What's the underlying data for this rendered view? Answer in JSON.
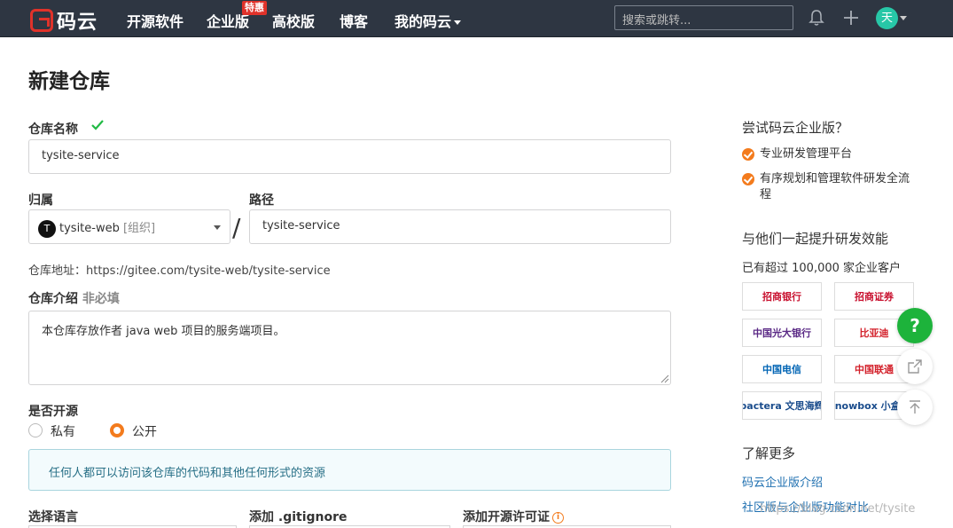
{
  "nav": {
    "logo_text": "码云",
    "items": [
      "开源软件",
      "企业版",
      "高校版",
      "博客",
      "我的码云"
    ],
    "badge": "特惠",
    "search_placeholder": "搜索或跳转...",
    "avatar_letter": "天"
  },
  "form": {
    "page_title": "新建仓库",
    "repo_name_label": "仓库名称",
    "repo_name_value": "tysite-service",
    "owner_label": "归属",
    "owner_initial": "T",
    "owner_name": "tysite-web",
    "owner_tag": "[组织]",
    "path_label": "路径",
    "path_value": "tysite-service",
    "repo_url": "仓库地址：https://gitee.com/tysite-web/tysite-service",
    "intro_label": "仓库介绍",
    "intro_optional": "非必填",
    "intro_value": "本仓库存放作者 java web 项目的服务端项目。",
    "open_source_label": "是否开源",
    "private_label": "私有",
    "public_label": "公开",
    "public_notice": "任何人都可以访问该仓库的代码和其他任何形式的资源",
    "language_label": "选择语言",
    "gitignore_label": "添加 .gitignore",
    "license_label": "添加开源许可证"
  },
  "sidebar": {
    "try_title": "尝试码云企业版？",
    "features": [
      "专业研发管理平台",
      "有序规划和管理软件研发全流程"
    ],
    "boost_title": "与他们一起提升研发效能",
    "customers_text": "已有超过 100,000 家企业客户",
    "logos": [
      "招商银行",
      "招商证券",
      "中国光大银行",
      "比亚迪",
      "中国电信",
      "中国联通",
      "pactera 文思海辉",
      "knowbox 小盒科技"
    ],
    "learn_more": "了解更多",
    "links": [
      "码云企业版介绍",
      "社区版与企业版功能对比"
    ]
  },
  "watermark": "https://blog.csdn.net/tysite",
  "float": {
    "help": "?"
  },
  "colors": {
    "nav_bg": "#2e3642",
    "brand_red": "#e0322a",
    "accent_orange": "#f37b1d",
    "success_green": "#1db33b",
    "link_blue": "#1e6fb0"
  }
}
